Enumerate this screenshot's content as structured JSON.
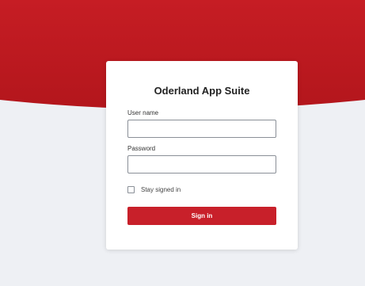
{
  "app": {
    "title": "Oderland App Suite"
  },
  "form": {
    "username_label": "User name",
    "username_value": "",
    "password_label": "Password",
    "password_value": "",
    "stay_signed_in_label": "Stay signed in",
    "stay_signed_in_checked": false,
    "sign_in_label": "Sign in"
  },
  "colors": {
    "brand_red": "#c8202a",
    "background": "#eef0f4",
    "card": "#ffffff"
  }
}
